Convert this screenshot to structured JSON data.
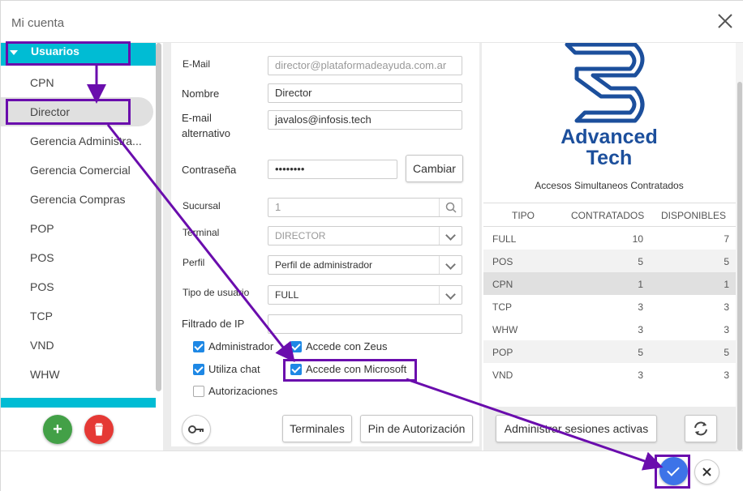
{
  "window": {
    "title": "Mi cuenta"
  },
  "sidebar": {
    "header": "Usuarios",
    "items": [
      {
        "label": "CPN"
      },
      {
        "label": "Director"
      },
      {
        "label": "Gerencia Administra..."
      },
      {
        "label": "Gerencia Comercial"
      },
      {
        "label": "Gerencia Compras"
      },
      {
        "label": "POP"
      },
      {
        "label": "POS"
      },
      {
        "label": "POS"
      },
      {
        "label": "TCP"
      },
      {
        "label": "VND"
      },
      {
        "label": "WHW"
      }
    ],
    "selected": "Director"
  },
  "form": {
    "email_label": "E-Mail",
    "email_value": "director@plataformadeayuda.com.ar",
    "nombre_label": "Nombre",
    "nombre_value": "Director",
    "email_alt_label_1": "E-mail",
    "email_alt_label_2": "alternativo",
    "email_alt_value": "javalos@infosis.tech",
    "password_label": "Contraseña",
    "password_value": "••••••••",
    "change_button": "Cambiar",
    "sucursal_label": "Sucursal",
    "sucursal_value": "1",
    "terminal_label": "Terminal",
    "terminal_value": "DIRECTOR",
    "perfil_label": "Perfil",
    "perfil_value": "Perfil de administrador",
    "tipo_label": "Tipo de usuario",
    "tipo_value": "FULL",
    "ip_label": "Filtrado de IP",
    "ip_value": "",
    "checks": {
      "administrador": {
        "label": "Administrador",
        "checked": true
      },
      "zeus": {
        "label": "Accede con Zeus",
        "checked": true
      },
      "chat": {
        "label": "Utiliza chat",
        "checked": true
      },
      "microsoft": {
        "label": "Accede con Microsoft",
        "checked": true
      },
      "autorizaciones": {
        "label": "Autorizaciones",
        "checked": false
      }
    },
    "terminales_button": "Terminales",
    "pin_button": "Pin de Autorización"
  },
  "right": {
    "logo_line1": "Advanced",
    "logo_line2": "Tech",
    "access_title": "Accesos Simultaneos Contratados",
    "table": {
      "headers": [
        "TIPO",
        "CONTRATADOS",
        "DISPONIBLES"
      ],
      "rows": [
        [
          "FULL",
          "10",
          "7"
        ],
        [
          "POS",
          "5",
          "5"
        ],
        [
          "CPN",
          "1",
          "1"
        ],
        [
          "TCP",
          "3",
          "3"
        ],
        [
          "WHW",
          "3",
          "3"
        ],
        [
          "POP",
          "5",
          "5"
        ],
        [
          "VND",
          "3",
          "3"
        ]
      ]
    },
    "sessions_button": "Administrar sesiones activas"
  },
  "colors": {
    "accent": "#00bcd4",
    "primary": "#3d73e8",
    "checkbox": "#1e88e5",
    "add": "#43a047",
    "delete": "#e53935",
    "annotation": "#6a0dad",
    "logo": "#1c4f9c"
  },
  "icons": [
    "close-icon",
    "plus-icon",
    "trash-icon",
    "key-icon",
    "search-icon",
    "refresh-icon",
    "check-icon",
    "x-icon",
    "chevron-down-icon",
    "caret-down-icon"
  ]
}
